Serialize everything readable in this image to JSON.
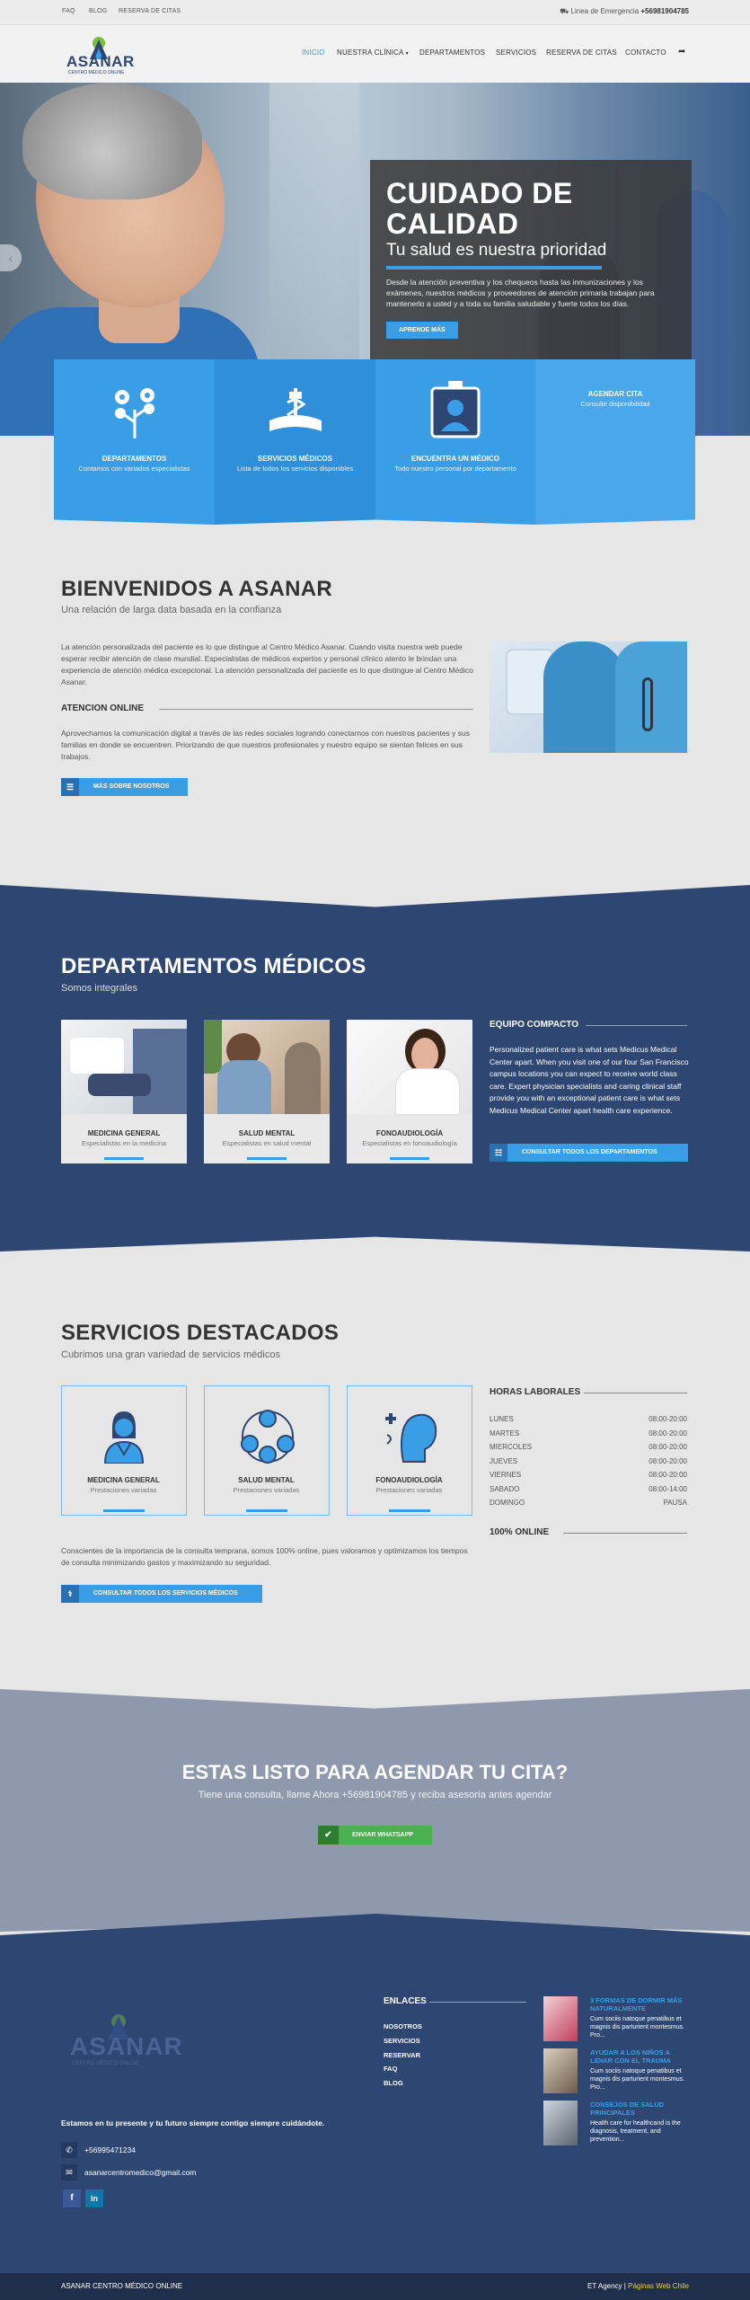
{
  "colors": {
    "accent": "#3a9ee6",
    "navy": "#2d4672",
    "cta": "#4caf50"
  },
  "topbar": {
    "links": [
      "FAQ",
      "BLOG",
      "RESERVA DE CITAS"
    ],
    "emergency_label": "Linea de Emergencia",
    "emergency_phone": "+56981904785"
  },
  "brand": {
    "name": "ASANAR",
    "tagline": "CENTRO MÉDICO ONLINE"
  },
  "nav": {
    "items": [
      "INICIO",
      "NUESTRA CLÍNICA",
      "DEPARTAMENTOS",
      "SERVICIOS",
      "RESERVA DE CITAS",
      "CONTACTO"
    ],
    "dropdown_icon": "chevron-down-icon",
    "share_icon": "share-icon"
  },
  "hero": {
    "title": "CUIDADO DE CALIDAD",
    "subtitle": "Tu salud es nuestra prioridad",
    "text": "Desde la atención preventiva y los chequeos hasta las inmunizaciones y los exámenes, nuestros médicos y proveedores de atención primaria trabajan para mantenerlo a usted y a toda su familia saludable y fuerte todos los días.",
    "button": "APRENDE MÁS",
    "prev_arrow": "‹"
  },
  "features": [
    {
      "title": "DEPARTAMENTOS",
      "sub": "Contamos con variados especialistas",
      "icon": "flowers-icon"
    },
    {
      "title": "SERVICIOS MÉDICOS",
      "sub": "Lista de todos los servicios disponibles",
      "icon": "medical-book-icon"
    },
    {
      "title": "ENCUENTRA UN MÉDICO",
      "sub": "Todo nuestro personal por departamento",
      "icon": "doctor-badge-icon"
    },
    {
      "title": "AGENDAR CITA",
      "sub": "Consulte disponibilidad",
      "icon": "calendar-icon"
    }
  ],
  "welcome": {
    "title": "BIENVENIDOS A ASANAR",
    "sub": "Una relación de larga data basada en la confianza",
    "p1": "La atención personalizada del paciente es lo que distingue al Centro Médico Asanar. Cuando visita nuestra web puede esperar recibir atención de clase mundial. Especialistas de médicos expertos y personal clínico atento le brindan una experiencia de atención médica excepcional. La atención personalizada del paciente es lo que distingue al Centro Médico Asanar.",
    "online_title": "ATENCION ONLINE",
    "p2": "Aprovechamos la comunicación digital a través de las redes sociales logrando conectarnos con nuestros pacientes y sus familias en donde se encuentren. Priorizando de que nuestros profesionales y nuestro equipo se sientan felices en sus trabajos.",
    "button": "MÁS SOBRE NOSOTROS"
  },
  "departments": {
    "title": "DEPARTAMENTOS MÉDICOS",
    "sub": "Somos integrales",
    "cards": [
      {
        "title": "MEDICINA GENERAL",
        "sub": "Especialistas en la medicina"
      },
      {
        "title": "SALUD MENTAL",
        "sub": "Especialistas en salud mental"
      },
      {
        "title": "FONOAUDIOLOGÍA",
        "sub": "Especialistas en fonoaudiología"
      }
    ],
    "side_title": "EQUIPO COMPACTO",
    "side_text": "Personalized patient care is what sets Medicus Medical Center apart. When you visit one of our four San Francisco campus locations you can expect to receive world class care. Expert physician specialists and caring clinical staff provide you with an exceptional patient care is what sets Medicus Medical Center apart health care experience.",
    "button": "CONSULTAR TODOS LOS DEPARTAMENTOS"
  },
  "services": {
    "title": "SERVICIOS DESTACADOS",
    "sub": "Cubrimos una gran variedad de servicios médicos",
    "cards": [
      {
        "title": "MEDICINA GENERAL",
        "sub": "Prestaciones variadas"
      },
      {
        "title": "SALUD MENTAL",
        "sub": "Prestaciones variadas"
      },
      {
        "title": "FONOAUDIOLOGÍA",
        "sub": "Prestaciones variadas"
      }
    ],
    "text": "Conscientes de la importancia de la consulta temprana, somos 100% online, pues valoramos y optimizamos los tiempos de consulta minimizando gastos y maximizando su seguridad.",
    "button": "CONSULTAR TODOS LOS SERVICIOS MÉDICOS",
    "hours_title": "HORAS LABORALES",
    "hours": [
      {
        "day": "LUNES",
        "time": "08:00-20:00"
      },
      {
        "day": "MARTES",
        "time": "08:00-20:00"
      },
      {
        "day": "MIERCOLES",
        "time": "08:00-20:00"
      },
      {
        "day": "JUEVES",
        "time": "08:00-20:00"
      },
      {
        "day": "VIERNES",
        "time": "08:00-20:00"
      },
      {
        "day": "SABADO",
        "time": "08:00-14:00"
      },
      {
        "day": "DOMINGO",
        "time": "PAUSA"
      }
    ],
    "online_title": "100% ONLINE"
  },
  "cta": {
    "title": "ESTAS LISTO PARA AGENDAR TU CITA?",
    "sub": "Tiene una consulta, llame Ahora +56981904785 y reciba asesoría antes agendar",
    "button": "ENVIAR WHATSAPP"
  },
  "footer": {
    "tagline": "Estamos en tu presente y tu futuro siempre contigo siempre cuidándote.",
    "phone": "+56995471234",
    "email": "asanarcentromedico@gmail.com",
    "social": [
      "f",
      "in"
    ],
    "links_title": "ENLACES",
    "links": [
      "NOSOTROS",
      "SERVICIOS",
      "RESERVAR",
      "FAQ",
      "BLOG"
    ],
    "posts": [
      {
        "title": "3 FORMAS DE DORMIR MÁS NATURALMENTE",
        "text": "Cum sociis natoque penatibus et magnis dis parturient montesmus. Pro..."
      },
      {
        "title": "AYUDAR A LOS NIÑOS A LIDIAR CON EL TRAUMA",
        "text": "Cum sociis natoque penatibus et magnis dis parturient montesmus. Pro..."
      },
      {
        "title": "CONSEJOS DE SALUD PRINCIPALES",
        "text": "Health care for healthcand is the diagnosis, treatment, and prevention..."
      }
    ]
  },
  "bottombar": {
    "left": "ASANAR CENTRO MÉDICO ONLINE",
    "right_a": "ET Agency",
    "sep": "|",
    "right_b": "Páginas Web Chile"
  }
}
